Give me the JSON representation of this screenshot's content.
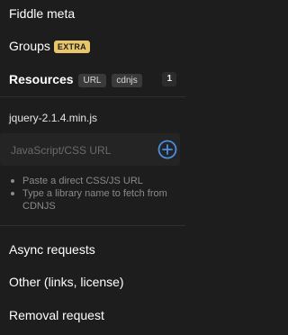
{
  "sections": {
    "fiddle_meta": "Fiddle meta",
    "groups": "Groups",
    "groups_badge": "EXTRA",
    "resources": "Resources",
    "resources_tags": [
      "URL",
      "cdnjs"
    ],
    "resources_count": "1",
    "async_requests": "Async requests",
    "other": "Other (links, license)",
    "removal_request": "Removal request"
  },
  "resources": {
    "files": [
      "jquery-2.1.4.min.js"
    ],
    "input_placeholder": "JavaScript/CSS URL",
    "input_value": "",
    "add_icon": "plus-circle-icon",
    "hints": [
      "Paste a direct CSS/JS URL",
      "Type a library name to fetch from CDNJS"
    ]
  },
  "colors": {
    "background": "#1d1d1d",
    "badge_extra": "#e8c46a",
    "accent_blue": "#4a8fe7"
  }
}
